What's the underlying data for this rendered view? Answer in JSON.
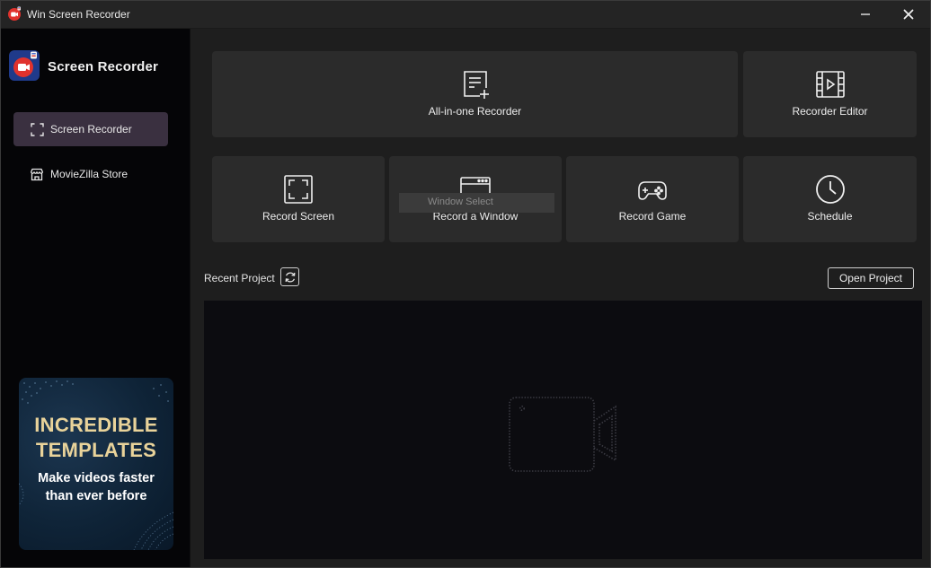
{
  "window": {
    "title": "Win Screen Recorder",
    "minimize_label": "—",
    "close_label": "✕"
  },
  "sidebar": {
    "brand": "Screen Recorder",
    "items": [
      {
        "label": "Screen Recorder",
        "icon": "screen-recorder-icon",
        "active": true
      },
      {
        "label": "MovieZilla Store",
        "icon": "store-icon",
        "active": false
      }
    ],
    "promo": {
      "headline_line1": "INCREDIBLE",
      "headline_line2": "TEMPLATES",
      "sub_line1": "Make videos faster",
      "sub_line2": "than ever before"
    }
  },
  "main": {
    "cards": [
      {
        "label": "All-in-one Recorder",
        "icon": "document-plus-icon"
      },
      {
        "label": "Recorder Editor",
        "icon": "film-editor-icon"
      },
      {
        "label": "Record Screen",
        "icon": "screen-frame-icon"
      },
      {
        "label": "Record a Window",
        "icon": "browser-window-icon"
      },
      {
        "label": "Record Game",
        "icon": "gamepad-icon"
      },
      {
        "label": "Schedule",
        "icon": "clock-icon"
      }
    ],
    "tooltip": "Window Select",
    "recent_project_label": "Recent Project",
    "open_project_label": "Open Project",
    "empty_state_icon": "video-camera-icon"
  },
  "colors": {
    "accent_red": "#e0322d",
    "active_nav": "#3a3040",
    "promo_gold": "#e9d39a",
    "card_bg": "#2b2b2b",
    "sidebar_bg": "#050507"
  }
}
